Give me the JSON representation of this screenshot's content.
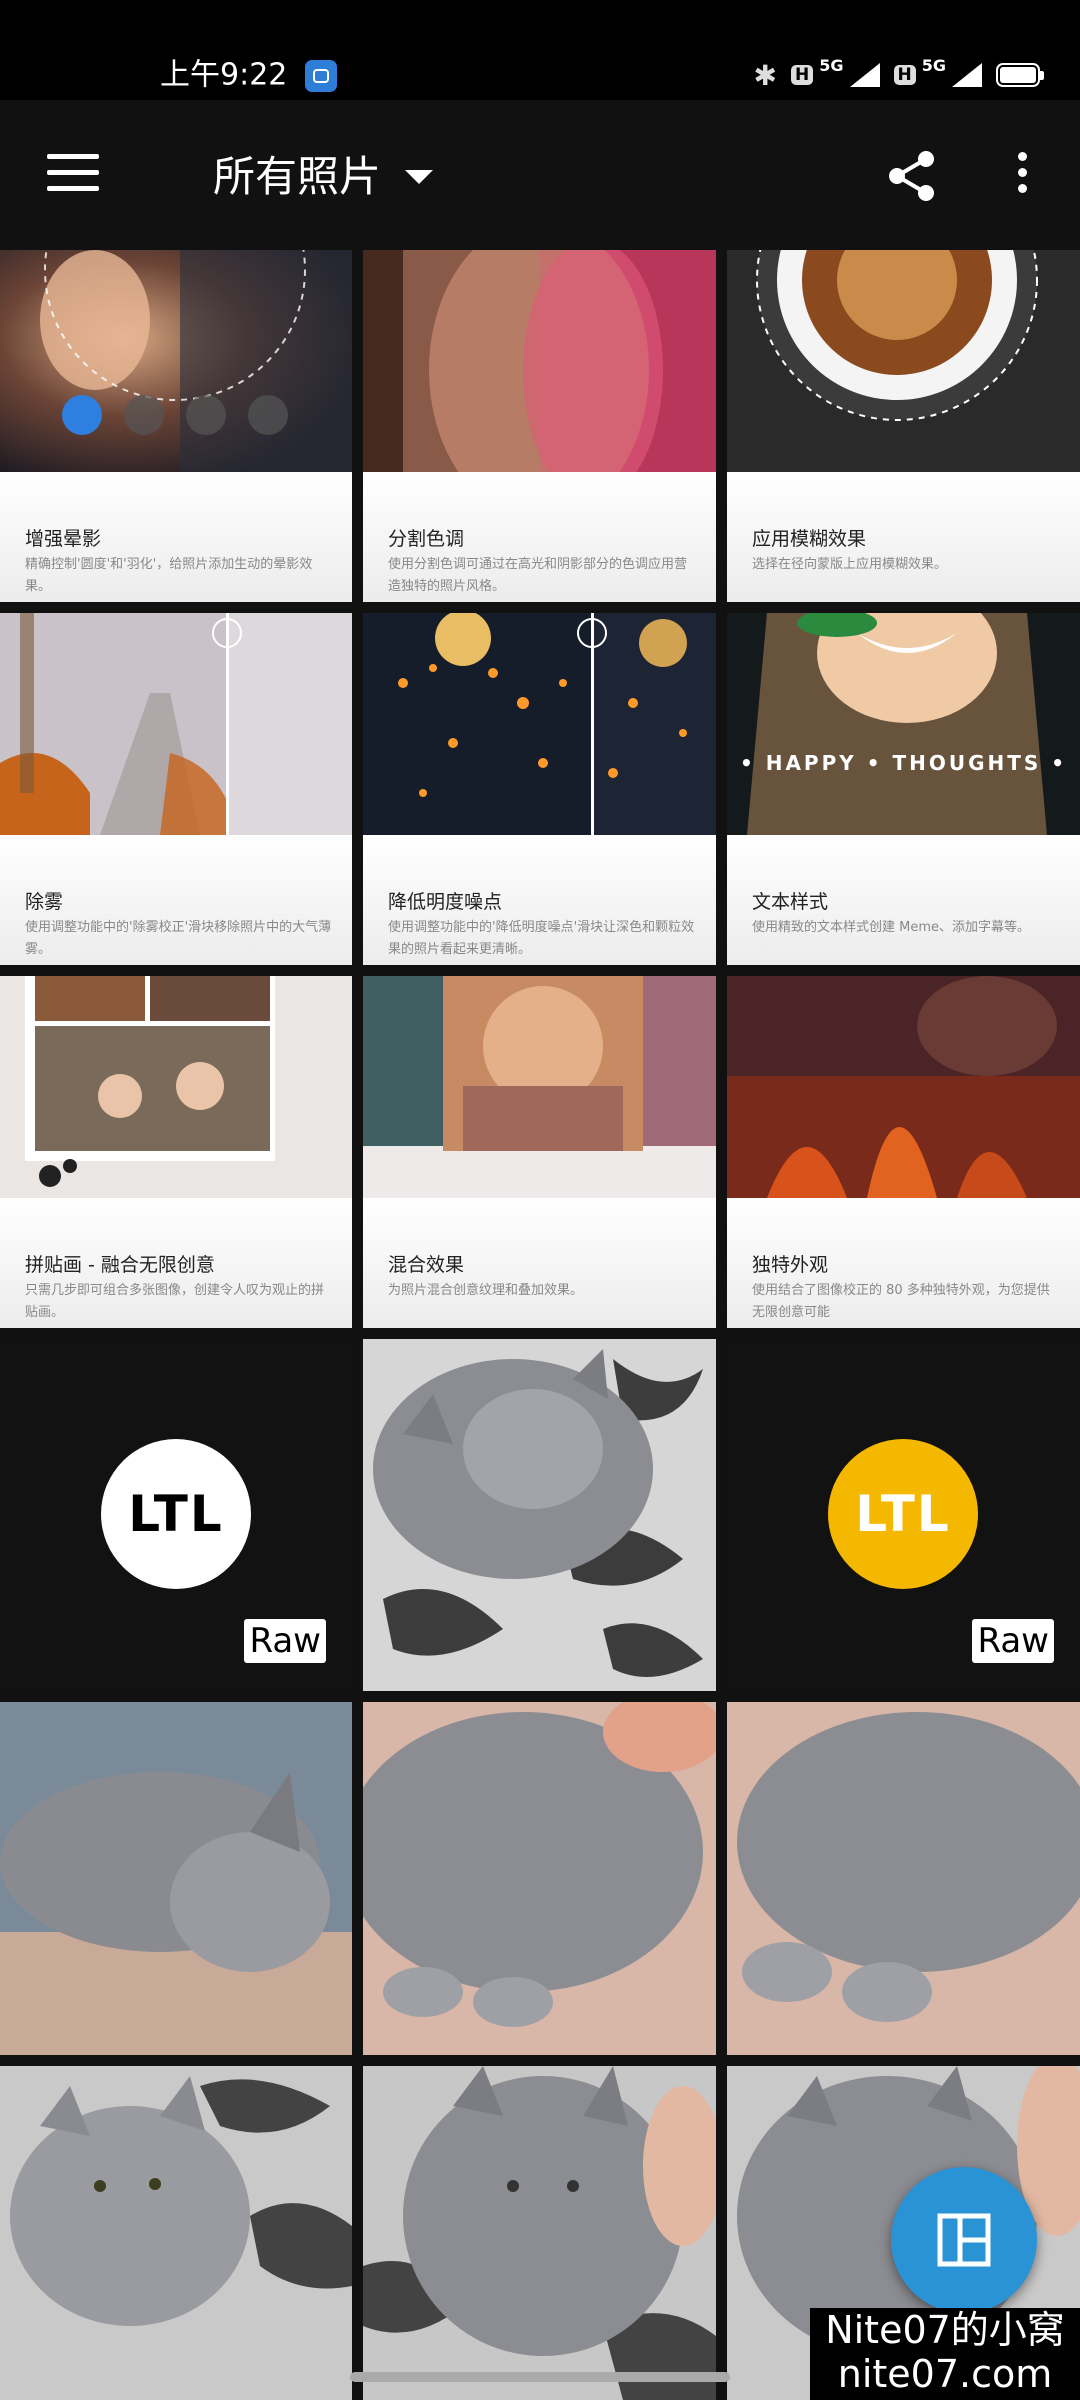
{
  "status_bar": {
    "time": "上午9:22",
    "signal_1": {
      "badge": "H",
      "network": "5G"
    },
    "signal_2": {
      "badge": "H",
      "network": "5G"
    }
  },
  "app_bar": {
    "title": "所有照片",
    "menu_icon": "hamburger-menu-icon",
    "share_icon": "share-icon",
    "more_icon": "more-vertical-icon"
  },
  "feature_tiles": [
    {
      "title": "增强晕影",
      "desc": "精确控制'圆度'和'羽化'，给照片添加生动的晕影效果。"
    },
    {
      "title": "分割色调",
      "desc": "使用分割色调可通过在高光和阴影部分的色调应用营造独特的照片风格。"
    },
    {
      "title": "应用模糊效果",
      "desc": "选择在径向蒙版上应用模糊效果。"
    },
    {
      "title": "除雾",
      "desc": "使用调整功能中的'除雾校正'滑块移除照片中的大气薄雾。"
    },
    {
      "title": "降低明度噪点",
      "desc": "使用调整功能中的'降低明度噪点'滑块让深色和颗粒效果的照片看起来更清晰。"
    },
    {
      "title": "文本样式",
      "desc": "使用精致的文本样式创建 Meme、添加字幕等。"
    },
    {
      "title": "拼贴画 - 融合无限创意",
      "desc": "只需几步即可组合多张图像，创建令人叹为观止的拼贴画。"
    },
    {
      "title": "混合效果",
      "desc": "为照片混合创意纹理和叠加效果。"
    },
    {
      "title": "独特外观",
      "desc": "使用结合了图像校正的 80 多种独特外观，为您提供无限创意可能"
    }
  ],
  "overlay_text": {
    "happy_thoughts": "• HAPPY • THOUGHTS •"
  },
  "raw_tiles": [
    {
      "logo_text": "LTL",
      "badge": "Raw",
      "logo_color": "#ffffff"
    },
    {
      "logo_text": "LTL",
      "badge": "Raw",
      "logo_color": "#f5b800"
    }
  ],
  "photos": [
    {
      "subject": "cat"
    },
    {
      "subject": "cat"
    },
    {
      "subject": "cat"
    },
    {
      "subject": "cat"
    },
    {
      "subject": "cat"
    },
    {
      "subject": "cat"
    },
    {
      "subject": "cat"
    }
  ],
  "fab": {
    "icon": "grid-layout-icon"
  },
  "watermark": {
    "line1": "Nite07的小窝",
    "line2": "nite07.com"
  }
}
